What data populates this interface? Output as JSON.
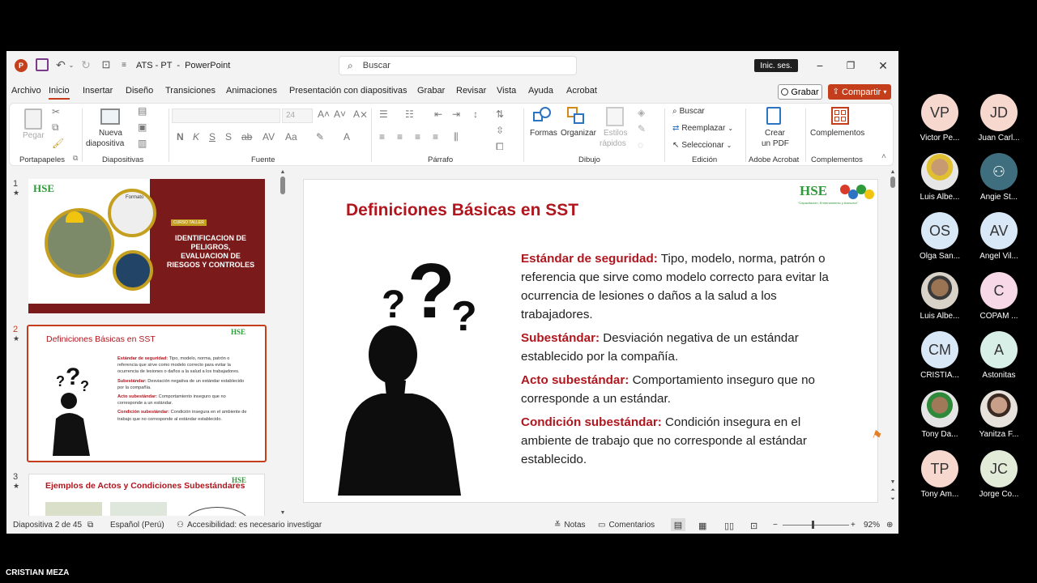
{
  "window": {
    "title": "ATS - PT  -  PowerPoint",
    "search_placeholder": "Buscar",
    "sign_in": "Inic. ses."
  },
  "tabs": [
    "Archivo",
    "Inicio",
    "Insertar",
    "Diseño",
    "Transiciones",
    "Animaciones",
    "Presentación con diapositivas",
    "Grabar",
    "Revisar",
    "Vista",
    "Ayuda",
    "Acrobat"
  ],
  "tab_buttons": {
    "record": "Grabar",
    "share": "Compartir"
  },
  "ribbon": {
    "paste": "Pegar",
    "new_slide_1": "Nueva",
    "new_slide_2": "diapositiva",
    "font_size": "24",
    "shapes": "Formas",
    "arrange": "Organizar",
    "quick_styles_1": "Estilos",
    "quick_styles_2": "rápidos",
    "find": "Buscar",
    "replace": "Reemplazar",
    "select": "Seleccionar",
    "create_pdf_1": "Crear",
    "create_pdf_2": "un PDF",
    "addins": "Complementos",
    "groups": {
      "clipboard": "Portapapeles",
      "slides": "Diapositivas",
      "font": "Fuente",
      "paragraph": "Párrafo",
      "drawing": "Dibujo",
      "editing": "Edición",
      "acrobat": "Adobe Acrobat",
      "addins": "Complementos"
    }
  },
  "thumbnails": {
    "slide1": {
      "num": "1",
      "brand": "HSE",
      "tag": "CURSO TALLER",
      "title": "IDENTIFICACION DE PELIGROS, EVALUACION DE RIESGOS Y CONTROLES",
      "screen_label": "Formato"
    },
    "slide2": {
      "num": "2",
      "title": "Definiciones Básicas en SST",
      "brand": "HSE",
      "t1": "Estándar de seguridad:",
      "d1": " Tipo, modelo, norma, patrón o referencia que sirve como modelo correcto para evitar la ocurrencia de lesiones o daños a la salud a los trabajadores.",
      "t2": "Subestándar:",
      "d2": " Desviación negativa de un estándar establecido por la compañía.",
      "t3": "Acto subestándar:",
      "d3": " Comportamiento inseguro que no corresponde a un estándar.",
      "t4": "Condición subestándar:",
      "d4": " Condición insegura en el ambiente de trabajo que no corresponde al estándar establecido."
    },
    "slide3": {
      "num": "3",
      "title": "Ejemplos de Actos y Condiciones Subestándares",
      "brand": "HSE"
    }
  },
  "slide": {
    "title": "Definiciones Básicas en SST",
    "brand": "HSE",
    "brand_tagline": "\"Capacitación, Entrenamiento y Asesoría\"",
    "defs": [
      {
        "term": "Estándar de seguridad:",
        "text": " Tipo, modelo, norma, patrón o referencia que sirve como modelo correcto para evitar la ocurrencia de lesiones o daños a la salud a los trabajadores."
      },
      {
        "term": "Subestándar:",
        "text": " Desviación negativa de un estándar establecido por la compañía."
      },
      {
        "term": "Acto subestándar:",
        "text": " Comportamiento inseguro que no corresponde a un estándar."
      },
      {
        "term": "Condición subestándar:",
        "text": " Condición insegura en el ambiente de trabajo que no corresponde al estándar establecido."
      }
    ]
  },
  "status": {
    "slide_count": "Diapositiva 2 de 45",
    "language": "Español (Perú)",
    "accessibility": "Accesibilidad: es necesario investigar",
    "notes": "Notas",
    "comments": "Comentarios",
    "zoom": "92%"
  },
  "participants": [
    {
      "initials": "VP",
      "name": "Victor Pe...",
      "color": "#f6d8cf"
    },
    {
      "initials": "JD",
      "name": "Juan Carl...",
      "color": "#f6d8cf"
    },
    {
      "initials": "",
      "name": "Luis Albe...",
      "color": "#d8c89a"
    },
    {
      "initials": "",
      "name": "Angie St...",
      "color": "#3f6f7f"
    },
    {
      "initials": "OS",
      "name": "Olga San...",
      "color": "#d9e8f7"
    },
    {
      "initials": "AV",
      "name": "Angel Vil...",
      "color": "#d9e8f7"
    },
    {
      "initials": "",
      "name": "Luis Albe...",
      "color": "#b8a38a"
    },
    {
      "initials": "C",
      "name": "COPAM ...",
      "color": "#f6d8e6"
    },
    {
      "initials": "CM",
      "name": "CRISTIA...",
      "color": "#d9e8f7"
    },
    {
      "initials": "A",
      "name": "Astonitas",
      "color": "#d8efe8"
    },
    {
      "initials": "",
      "name": "Tony Da...",
      "color": "#c9b48a"
    },
    {
      "initials": "",
      "name": "Yanitza F...",
      "color": "#d9ccc2"
    },
    {
      "initials": "TP",
      "name": "Tony Am...",
      "color": "#f6d8cf"
    },
    {
      "initials": "JC",
      "name": "Jorge Co...",
      "color": "#e2ead8"
    }
  ],
  "self_name": "CRISTIAN MEZA",
  "colors": {
    "accent": "#c43e1c",
    "slide_title": "#b0161e",
    "hse_green": "#2e9a3a"
  }
}
